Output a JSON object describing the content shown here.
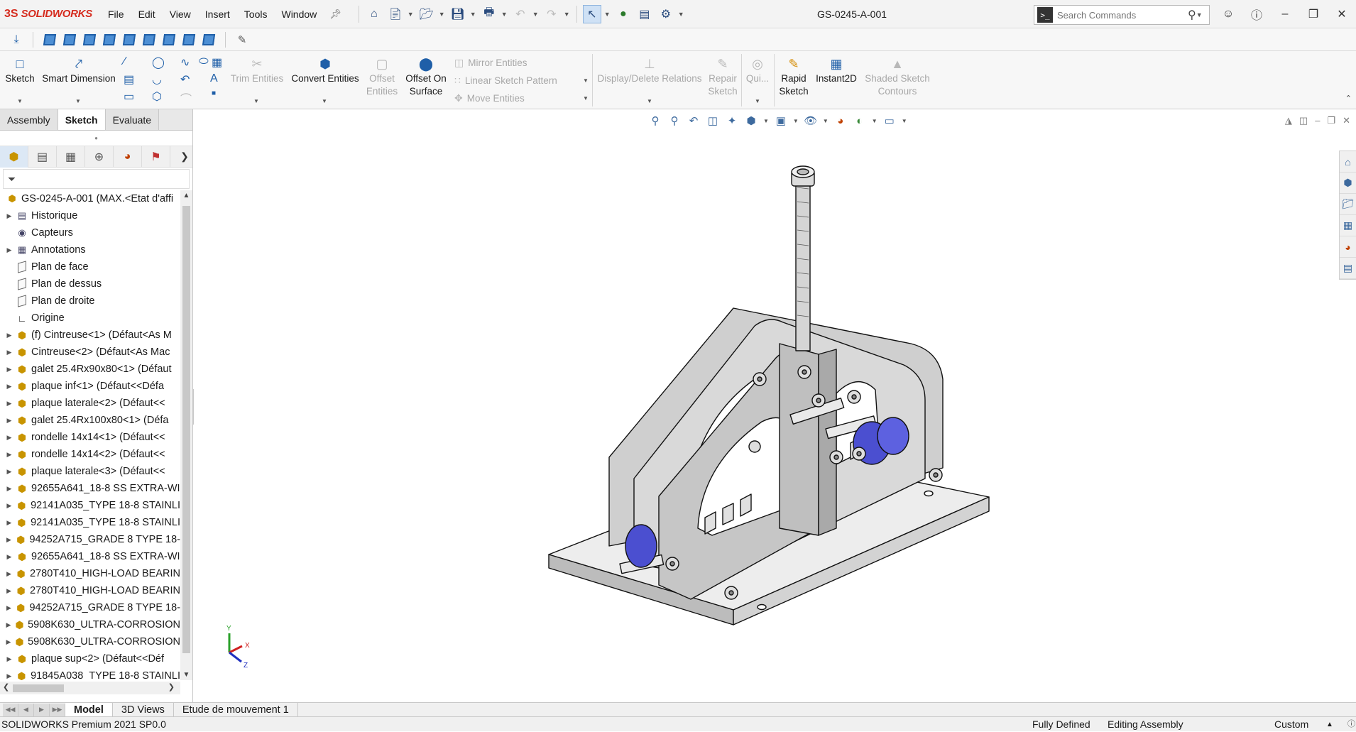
{
  "app": {
    "brand": "SOLIDWORKS",
    "logo_mark": "3S"
  },
  "menu": [
    "File",
    "Edit",
    "View",
    "Insert",
    "Tools",
    "Window"
  ],
  "document_title": "GS-0245-A-001",
  "search": {
    "placeholder": "Search Commands",
    "prompt_glyph": ">_"
  },
  "ribbon": {
    "sketch": "Sketch",
    "smart_dimension": "Smart Dimension",
    "trim_entities": "Trim Entities",
    "convert_entities": "Convert Entities",
    "offset_entities_1": "Offset",
    "offset_entities_2": "Entities",
    "offset_on_surface_1": "Offset On",
    "offset_on_surface_2": "Surface",
    "mirror_entities": "Mirror Entities",
    "linear_sketch_pattern": "Linear Sketch Pattern",
    "move_entities": "Move Entities",
    "display_delete_relations": "Display/Delete Relations",
    "repair_sketch_1": "Repair",
    "repair_sketch_2": "Sketch",
    "quick_snaps": "Qui...",
    "rapid_sketch_1": "Rapid",
    "rapid_sketch_2": "Sketch",
    "instant2d": "Instant2D",
    "shaded_contours_1": "Shaded Sketch",
    "shaded_contours_2": "Contours"
  },
  "command_tabs": [
    "Assembly",
    "Sketch",
    "Evaluate"
  ],
  "active_command_tab": "Sketch",
  "tree": {
    "root": "GS-0245-A-001  (MAX.<Etat d'affi",
    "items": [
      {
        "label": "Historique",
        "icon": "history-folder",
        "expand": true
      },
      {
        "label": "Capteurs",
        "icon": "sensor-folder",
        "expand": false
      },
      {
        "label": "Annotations",
        "icon": "annotation-folder",
        "expand": true
      },
      {
        "label": "Plan de face",
        "icon": "plane",
        "expand": false
      },
      {
        "label": "Plan de dessus",
        "icon": "plane",
        "expand": false
      },
      {
        "label": "Plan de droite",
        "icon": "plane",
        "expand": false
      },
      {
        "label": "Origine",
        "icon": "origin",
        "expand": false
      },
      {
        "label": "(f) Cintreuse<1> (Défaut<As M",
        "icon": "part",
        "expand": true
      },
      {
        "label": "Cintreuse<2> (Défaut<As Mac",
        "icon": "part",
        "expand": true
      },
      {
        "label": "galet 25.4Rx90x80<1> (Défaut",
        "icon": "part",
        "expand": true
      },
      {
        "label": "plaque inf<1> (Défaut<<Défa",
        "icon": "part",
        "expand": true
      },
      {
        "label": "plaque laterale<2> (Défaut<<",
        "icon": "part",
        "expand": true
      },
      {
        "label": "galet  25.4Rx100x80<1> (Défa",
        "icon": "part",
        "expand": true
      },
      {
        "label": "rondelle 14x14<1> (Défaut<<",
        "icon": "part",
        "expand": true
      },
      {
        "label": "rondelle 14x14<2> (Défaut<<",
        "icon": "part",
        "expand": true
      },
      {
        "label": "plaque laterale<3> (Défaut<<",
        "icon": "part",
        "expand": true
      },
      {
        "label": "92655A641_18-8 SS EXTRA-WI",
        "icon": "part",
        "expand": true
      },
      {
        "label": "92141A035_TYPE 18-8 STAINLI",
        "icon": "part",
        "expand": true
      },
      {
        "label": "92141A035_TYPE 18-8 STAINLI",
        "icon": "part",
        "expand": true
      },
      {
        "label": "94252A715_GRADE 8 TYPE 18-",
        "icon": "part",
        "expand": true
      },
      {
        "label": "92655A641_18-8 SS EXTRA-WI",
        "icon": "part",
        "expand": true
      },
      {
        "label": "2780T410_HIGH-LOAD BEARIN",
        "icon": "part",
        "expand": true
      },
      {
        "label": "2780T410_HIGH-LOAD BEARIN",
        "icon": "part",
        "expand": true
      },
      {
        "label": "94252A715_GRADE 8 TYPE 18-",
        "icon": "part",
        "expand": true
      },
      {
        "label": "5908K630_ULTRA-CORROSION",
        "icon": "part",
        "expand": true
      },
      {
        "label": "5908K630_ULTRA-CORROSION",
        "icon": "part",
        "expand": true
      },
      {
        "label": "plaque sup<2> (Défaut<<Déf",
        "icon": "part",
        "expand": true
      },
      {
        "label": "91845A038_TYPE 18-8 STAINLI",
        "icon": "part",
        "expand": true
      }
    ]
  },
  "triad": {
    "x": "X",
    "y": "Y",
    "z": "Z"
  },
  "bottom_tabs": [
    "Model",
    "3D Views",
    "Etude de mouvement 1"
  ],
  "active_bottom_tab": "Model",
  "status": {
    "version": "SOLIDWORKS Premium 2021 SP0.0",
    "definition": "Fully Defined",
    "mode": "Editing Assembly",
    "units": "Custom"
  },
  "colors": {
    "brand_red": "#d52b1e",
    "accent_blue": "#1f5fa8",
    "roller_blue": "#4b4fd0",
    "part_grey": "#c9c9c9"
  }
}
